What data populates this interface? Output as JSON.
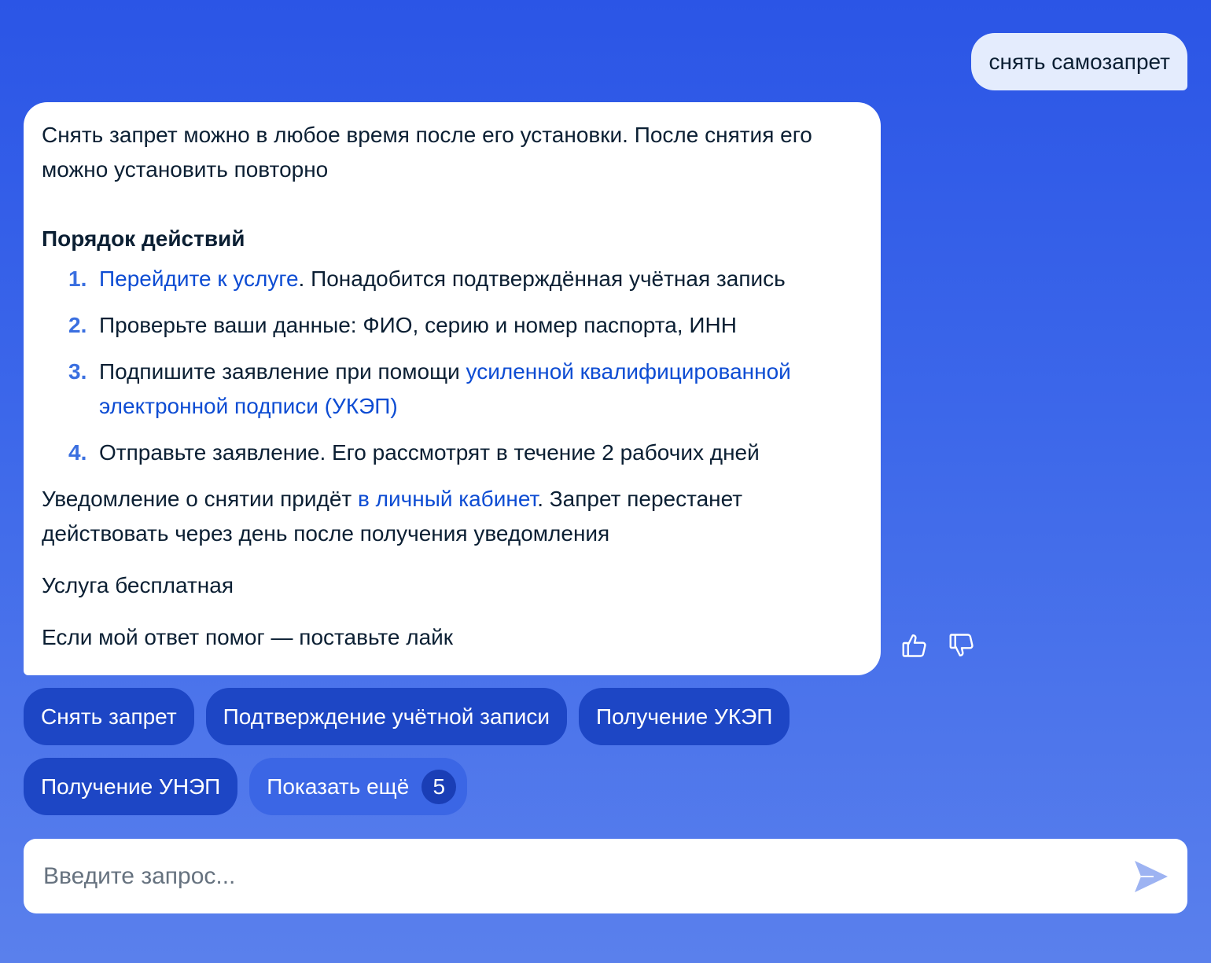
{
  "user_message": "снять самозапрет",
  "bot_message": {
    "intro": "Снять запрет можно в любое время после его установки. После снятия его можно установить повторно",
    "steps_title": "Порядок действий",
    "steps": [
      {
        "num": "1.",
        "link": "Перейдите к услуге",
        "after": ". Понадобится подтверждённая учётная запись"
      },
      {
        "num": "2.",
        "text": "Проверьте ваши данные: ФИО, серию и номер паспорта, ИНН"
      },
      {
        "num": "3.",
        "before": "Подпишите заявление при помощи ",
        "link": "усиленной квалифицированной электронной подписи (УКЭП)"
      },
      {
        "num": "4.",
        "text": "Отправьте заявление. Его рассмотрят в течение 2 рабочих дней"
      }
    ],
    "note_before": "Уведомление о снятии придёт ",
    "note_link": "в личный кабинет",
    "note_after": ". Запрет перестанет действовать через день после получения уведомления",
    "free": "Услуга бесплатная",
    "feedback": "Если мой ответ помог — поставьте лайк"
  },
  "reactions": {
    "like_icon": "thumbs-up-icon",
    "dislike_icon": "thumbs-down-icon"
  },
  "chips": [
    "Снять запрет",
    "Подтверждение учётной записи",
    "Получение УКЭП",
    "Получение УНЭП"
  ],
  "show_more": {
    "label": "Показать ещё",
    "count": "5"
  },
  "input": {
    "placeholder": "Введите запрос..."
  },
  "colors": {
    "background_top": "#2b55e6",
    "background_bottom": "#5a80ec",
    "chip": "#1d46c5",
    "link": "#0d4cd3",
    "step_number": "#3a6fe0"
  }
}
